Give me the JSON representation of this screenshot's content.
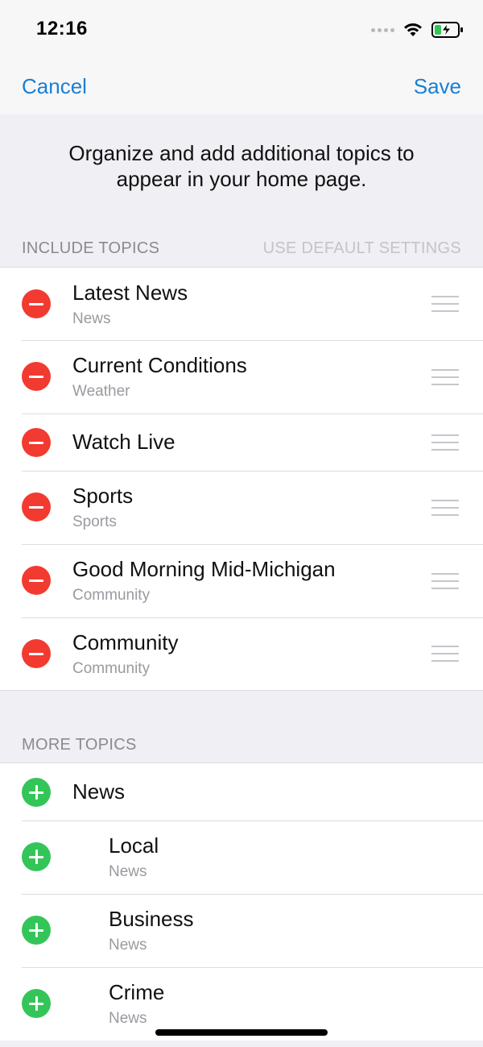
{
  "status_bar": {
    "time": "12:16",
    "icons": [
      "signal-dots-icon",
      "wifi-icon",
      "battery-charging-icon"
    ]
  },
  "nav": {
    "cancel_label": "Cancel",
    "save_label": "Save"
  },
  "intro_text": "Organize and add additional topics to appear in your home page.",
  "include_section": {
    "title": "INCLUDE TOPICS",
    "action_label": "USE DEFAULT SETTINGS",
    "items": [
      {
        "title": "Latest News",
        "subtitle": "News"
      },
      {
        "title": "Current Conditions",
        "subtitle": "Weather"
      },
      {
        "title": "Watch Live",
        "subtitle": ""
      },
      {
        "title": "Sports",
        "subtitle": "Sports"
      },
      {
        "title": "Good Morning Mid-Michigan",
        "subtitle": "Community"
      },
      {
        "title": "Community",
        "subtitle": "Community"
      }
    ]
  },
  "more_section": {
    "title": "MORE TOPICS",
    "items": [
      {
        "title": "News",
        "subtitle": ""
      },
      {
        "title": "Local",
        "subtitle": "News"
      },
      {
        "title": "Business",
        "subtitle": "News"
      },
      {
        "title": "Crime",
        "subtitle": "News"
      }
    ]
  },
  "colors": {
    "accent": "#1a7fd4",
    "remove": "#f23a30",
    "add": "#34c559"
  }
}
